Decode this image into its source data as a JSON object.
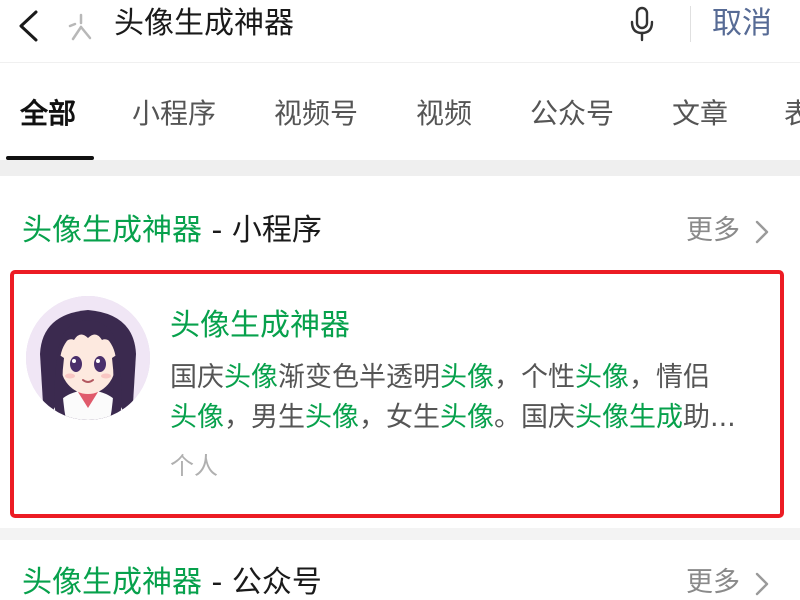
{
  "search": {
    "query": "头像生成神器",
    "cancel_label": "取消"
  },
  "tabs": [
    {
      "label": "全部",
      "active": true
    },
    {
      "label": "小程序"
    },
    {
      "label": "视频号"
    },
    {
      "label": "视频"
    },
    {
      "label": "公众号"
    },
    {
      "label": "文章"
    },
    {
      "label": "表"
    }
  ],
  "sections": {
    "mini_program": {
      "keyword": "头像生成神器",
      "suffix": " - 小程序",
      "more_label": "更多"
    },
    "official_account": {
      "keyword": "头像生成神器",
      "suffix": " - 公众号",
      "more_label": "更多"
    }
  },
  "result": {
    "title": "头像生成神器",
    "desc_line1": [
      {
        "text": "国庆",
        "hl": false
      },
      {
        "text": "头像",
        "hl": true
      },
      {
        "text": "渐变色半透明",
        "hl": false
      },
      {
        "text": "头像",
        "hl": true
      },
      {
        "text": "，个性",
        "hl": false
      },
      {
        "text": "头像",
        "hl": true
      },
      {
        "text": "，情侣",
        "hl": false
      }
    ],
    "desc_line2": [
      {
        "text": "头像",
        "hl": true
      },
      {
        "text": "，男生",
        "hl": false
      },
      {
        "text": "头像",
        "hl": true
      },
      {
        "text": "，女生",
        "hl": false
      },
      {
        "text": "头像",
        "hl": true
      },
      {
        "text": "。国庆",
        "hl": false
      },
      {
        "text": "头像生成",
        "hl": true
      },
      {
        "text": "助...",
        "hl": false
      }
    ],
    "tag": "个人"
  },
  "colors": {
    "keyword_green": "#07a14c",
    "highlight_border": "#ec1c24",
    "link_blue": "#576b95"
  },
  "icons": [
    "back-arrow-icon",
    "search-sparkle-icon",
    "microphone-icon",
    "chevron-right-icon"
  ]
}
